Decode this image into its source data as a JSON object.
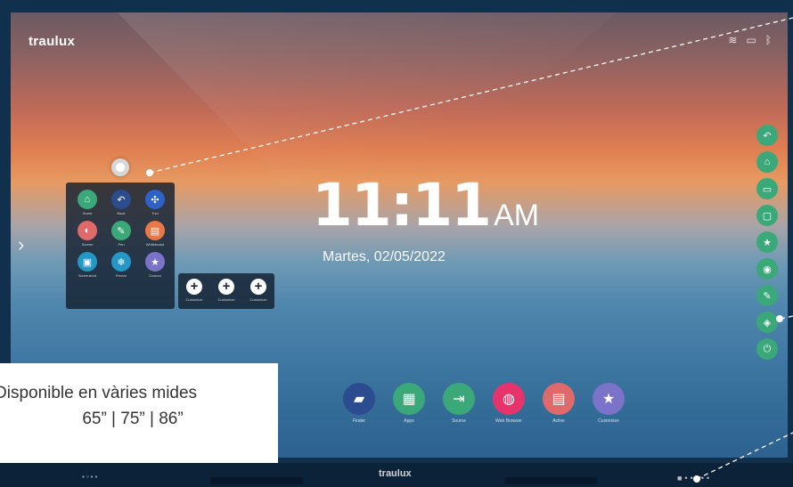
{
  "screen": {
    "brand": "traulux",
    "status_icons": [
      "wifi-icon",
      "monitor-icon",
      "bluetooth-icon"
    ]
  },
  "clock": {
    "time": "11:11",
    "ampm": "AM",
    "date": "Martes, 02/05/2022"
  },
  "quick_panel": {
    "items": [
      {
        "label": "Home",
        "icon": "home-icon",
        "color": "#3aa878"
      },
      {
        "label": "Back",
        "icon": "back-icon",
        "color": "#2b4c8f"
      },
      {
        "label": "Tool",
        "icon": "tool-icon",
        "color": "#2d63c8"
      },
      {
        "label": "Screen",
        "icon": "eraser-icon",
        "color": "#e06a6a"
      },
      {
        "label": "Pen",
        "icon": "pen-icon",
        "color": "#3aa878"
      },
      {
        "label": "Whiteboard",
        "icon": "whiteboard-icon",
        "color": "#e8774a"
      },
      {
        "label": "Screenshot",
        "icon": "screenshot-icon",
        "color": "#2597c7"
      },
      {
        "label": "Freeze",
        "icon": "freeze-icon",
        "color": "#2597c7"
      },
      {
        "label": "Custom",
        "icon": "star-icon",
        "color": "#7b73c9"
      }
    ]
  },
  "custom_panel": {
    "items": [
      {
        "label": "Customize"
      },
      {
        "label": "Customize"
      },
      {
        "label": "Customize"
      }
    ]
  },
  "side_toolbar": {
    "buttons": [
      "back-icon",
      "home-icon",
      "monitor-icon",
      "window-icon",
      "star-icon",
      "settings-icon",
      "pen-icon",
      "layers-icon",
      "power-icon"
    ],
    "color": "#3aa878"
  },
  "dock": {
    "items": [
      {
        "label": "Finder",
        "icon": "folder-icon",
        "color": "#2b4c8f"
      },
      {
        "label": "Apps",
        "icon": "apps-icon",
        "color": "#3aa878"
      },
      {
        "label": "Source",
        "icon": "source-icon",
        "color": "#3aa878"
      },
      {
        "label": "Web Browser",
        "icon": "globe-icon",
        "color": "#e6336b"
      },
      {
        "label": "Active",
        "icon": "active-icon",
        "color": "#e06a6a"
      },
      {
        "label": "Customize",
        "icon": "star-icon",
        "color": "#7b73c9"
      }
    ]
  },
  "callout": {
    "line1": "Disponible en vàries mides",
    "line2": "65” | 75” | 86”"
  },
  "bottom_bar": {
    "brand": "traulux"
  }
}
